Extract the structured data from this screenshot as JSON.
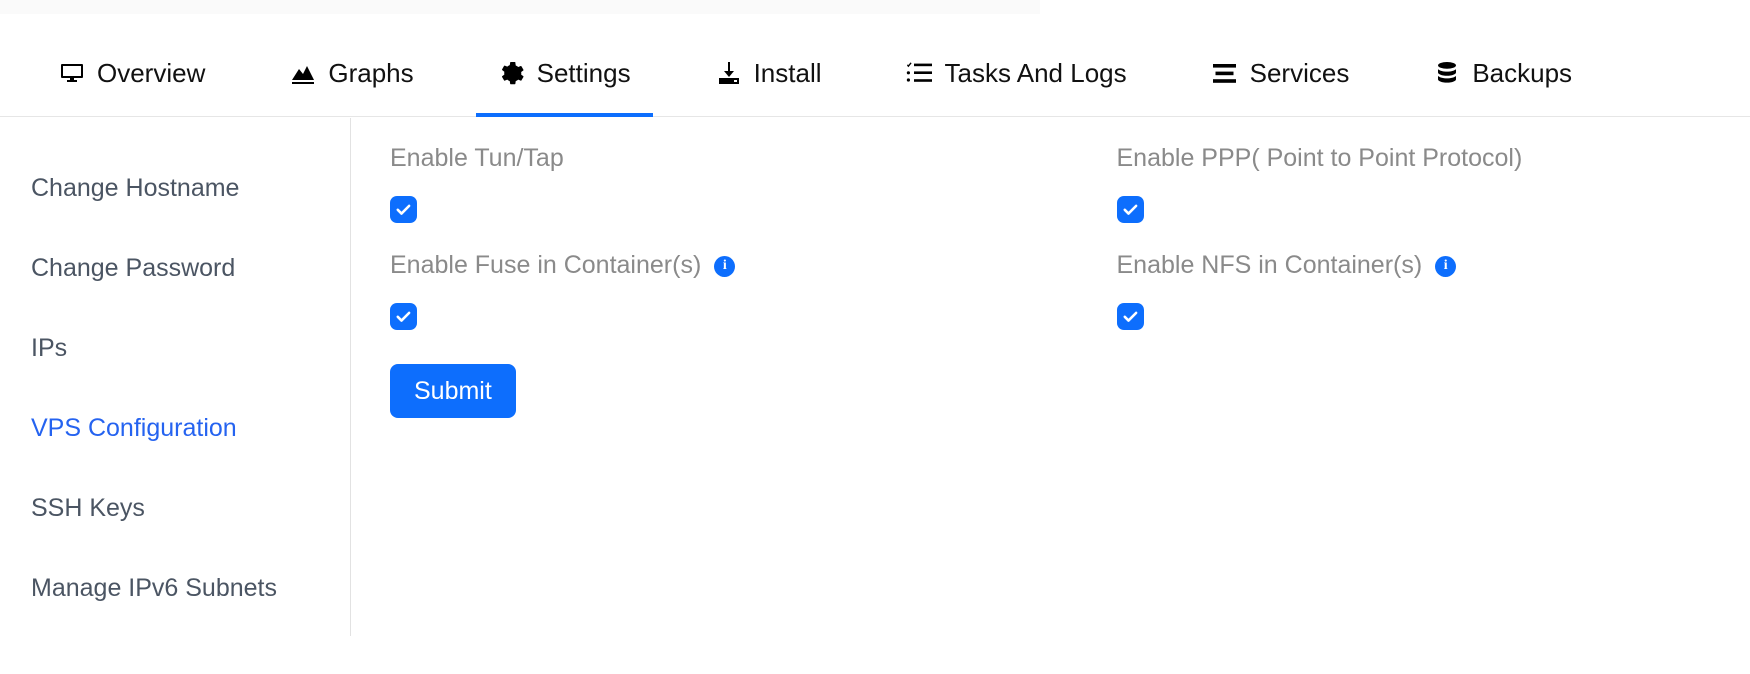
{
  "nav": {
    "items": [
      {
        "label": "Overview",
        "icon": "monitor-icon",
        "active": false
      },
      {
        "label": "Graphs",
        "icon": "chart-area-icon",
        "active": false
      },
      {
        "label": "Settings",
        "icon": "gear-icon",
        "active": true
      },
      {
        "label": "Install",
        "icon": "download-icon",
        "active": false
      },
      {
        "label": "Tasks And Logs",
        "icon": "tasklist-icon",
        "active": false
      },
      {
        "label": "Services",
        "icon": "menu-bars-icon",
        "active": false
      },
      {
        "label": "Backups",
        "icon": "database-icon",
        "active": false
      }
    ]
  },
  "sidebar": {
    "items": [
      {
        "label": "Change Hostname",
        "active": false
      },
      {
        "label": "Change Password",
        "active": false
      },
      {
        "label": "IPs",
        "active": false
      },
      {
        "label": "VPS Configuration",
        "active": true
      },
      {
        "label": "SSH Keys",
        "active": false
      },
      {
        "label": "Manage IPv6 Subnets",
        "active": false
      }
    ]
  },
  "main": {
    "fields": [
      {
        "label": "Enable Tun/Tap",
        "checked": true,
        "info": false
      },
      {
        "label": "Enable PPP( Point to Point Protocol)",
        "checked": true,
        "info": false
      },
      {
        "label": "Enable Fuse in Container(s)",
        "checked": true,
        "info": true
      },
      {
        "label": "Enable NFS in Container(s)",
        "checked": true,
        "info": true
      }
    ],
    "info_glyph": "i",
    "submit_label": "Submit"
  },
  "colors": {
    "accent": "#0d6efd",
    "sidebar_active": "#2563f0",
    "label_grey": "#8a8a8a",
    "sidebar_text": "#4b5563"
  }
}
